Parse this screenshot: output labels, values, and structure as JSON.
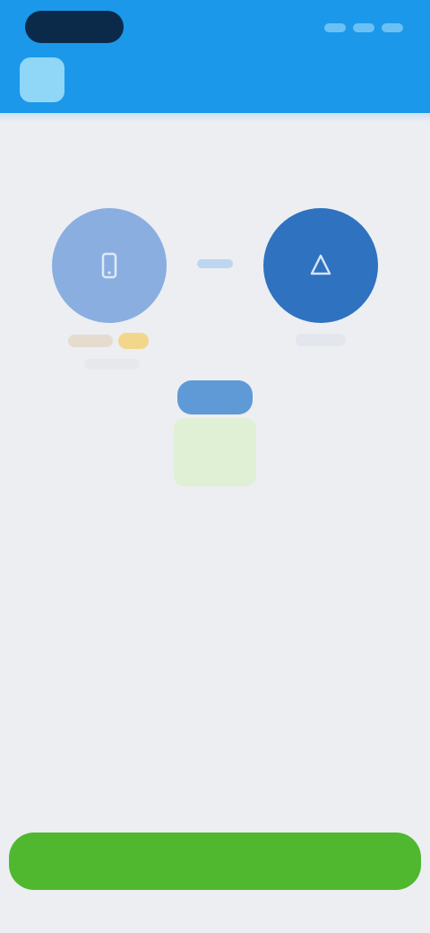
{
  "status_bar": {
    "time": "",
    "icons": [
      "signal-icon",
      "wifi-icon",
      "battery-icon"
    ]
  },
  "header": {
    "title": "",
    "icon": "app-icon"
  },
  "connection": {
    "left_node": {
      "icon": "phone-icon",
      "label": ""
    },
    "right_node": {
      "icon": "device-icon",
      "label": ""
    }
  },
  "action": {
    "button_label": ""
  },
  "colors": {
    "header": "#1b98ea",
    "left_node": "#8aaee0",
    "right_node": "#2f72c0",
    "button": "#4fb82f",
    "background": "#eceef2"
  }
}
